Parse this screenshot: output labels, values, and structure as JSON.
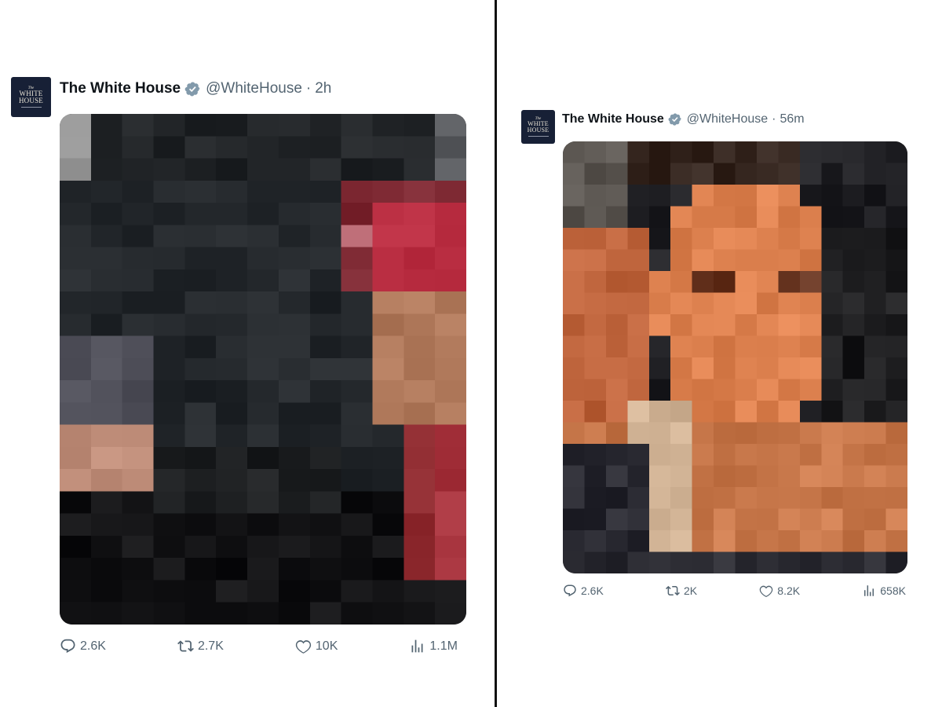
{
  "colors": {
    "text": "#0f1419",
    "secondary": "#536471",
    "verified_badge": "#829aab",
    "avatar_bg": "#172036"
  },
  "tweets": [
    {
      "author": {
        "name": "The White House",
        "handle": "@WhiteHouse",
        "avatar_text_small": "The",
        "avatar_text_line1": "WHITE",
        "avatar_text_line2": "HOUSE"
      },
      "time": "2h",
      "separator": "·",
      "media": {
        "description_icon": "pixelated-photo",
        "cols": 13,
        "rows": 23
      },
      "stats": {
        "replies": "2.6K",
        "reposts": "2.7K",
        "likes": "10K",
        "views": "1.1M"
      }
    },
    {
      "author": {
        "name": "The White House",
        "handle": "@WhiteHouse",
        "avatar_text_small": "The",
        "avatar_text_line1": "WHITE",
        "avatar_text_line2": "HOUSE"
      },
      "time": "56m",
      "separator": "·",
      "media": {
        "description_icon": "pixelated-photo",
        "cols": 16,
        "rows": 20
      },
      "stats": {
        "replies": "2.6K",
        "reposts": "2K",
        "likes": "8.2K",
        "views": "658K"
      }
    }
  ]
}
